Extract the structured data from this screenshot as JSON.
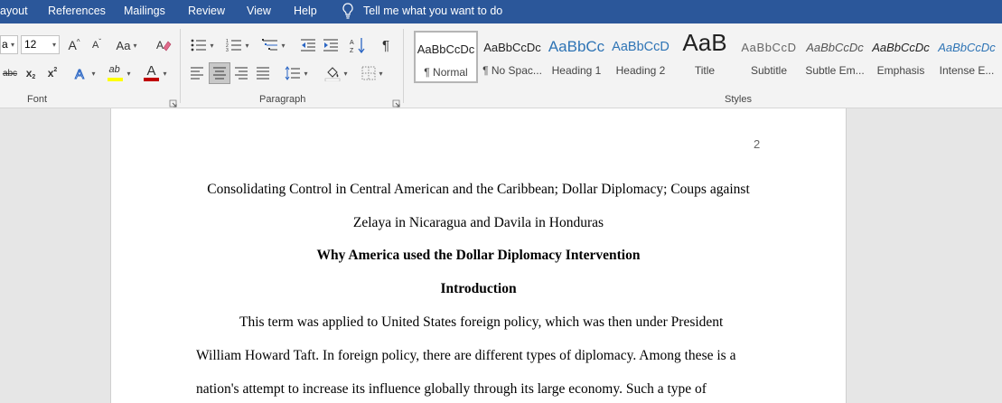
{
  "menu": {
    "layout": "ayout",
    "references": "References",
    "mailings": "Mailings",
    "review": "Review",
    "view": "View",
    "help": "Help",
    "tell_me": "Tell me what you want to do"
  },
  "font_group": {
    "font_name": "a",
    "font_size": "12",
    "grow": "A",
    "shrink": "A",
    "change_case": "Aa",
    "strikethrough": "abc",
    "subscript": "x",
    "superscript": "x",
    "highlight": "ab",
    "font_color": "A",
    "label": "Font"
  },
  "paragraph_group": {
    "show_marks": "¶",
    "label": "Paragraph"
  },
  "styles_group": {
    "label": "Styles",
    "items": [
      {
        "sample": "AaBbCcDc",
        "name": "¶ Normal"
      },
      {
        "sample": "AaBbCcDc",
        "name": "¶ No Spac..."
      },
      {
        "sample": "AaBbCc",
        "name": "Heading 1"
      },
      {
        "sample": "AaBbCcD",
        "name": "Heading 2"
      },
      {
        "sample": "AaB",
        "name": "Title"
      },
      {
        "sample": "AaBbCcD",
        "name": "Subtitle"
      },
      {
        "sample": "AaBbCcDc",
        "name": "Subtle Em..."
      },
      {
        "sample": "AaBbCcDc",
        "name": "Emphasis"
      },
      {
        "sample": "AaBbCcDc",
        "name": "Intense E..."
      }
    ]
  },
  "document": {
    "page_number": "2",
    "title_line1": "Consolidating Control in Central American and the Caribbean; Dollar Diplomacy; Coups against",
    "title_line2": "Zelaya in Nicaragua and Davila in Honduras",
    "heading": "Why America used the Dollar Diplomacy Intervention",
    "subheading": "Introduction",
    "body": [
      "This term was applied to United States foreign policy, which was then under President",
      "William Howard Taft. In foreign policy, there are different types of diplomacy. Among these is a",
      "nation's attempt to increase its influence globally through its large economy. Such a type of"
    ]
  },
  "colors": {
    "menubar": "#2b579a",
    "ribbon": "#f3f3f3",
    "workspace": "#e6e6e6",
    "font_color_bar": "#c00000",
    "highlight_bar": "#ffff00",
    "text_effects": "#2b66c4"
  }
}
